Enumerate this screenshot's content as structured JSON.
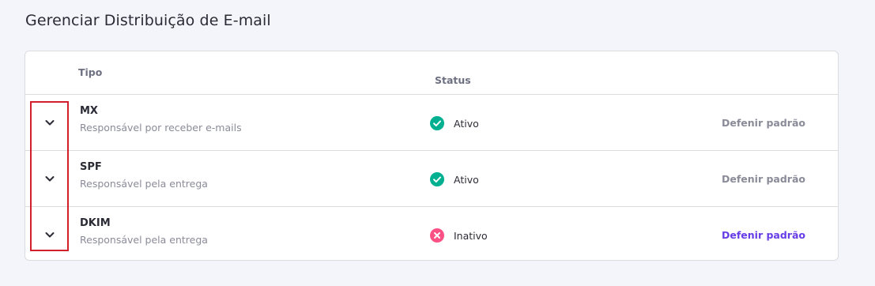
{
  "page": {
    "title": "Gerenciar Distribuição de E-mail"
  },
  "table": {
    "headers": {
      "type": "Tipo",
      "status": "Status"
    },
    "rows": [
      {
        "name": "MX",
        "description": "Responsável por receber e-mails",
        "status": "Ativo",
        "status_icon": "check-circle-icon",
        "action": "Defenir padrão",
        "action_state": "default"
      },
      {
        "name": "SPF",
        "description": "Responsável pela entrega",
        "status": "Ativo",
        "status_icon": "check-circle-icon",
        "action": "Defenir padrão",
        "action_state": "default"
      },
      {
        "name": "DKIM",
        "description": "Responsável pela entrega",
        "status": "Inativo",
        "status_icon": "x-circle-icon",
        "action": "Defenir padrão",
        "action_state": "active"
      }
    ]
  },
  "colors": {
    "background": "#f4f5fa",
    "active_green": "#00b090",
    "inactive_red": "#fc5185",
    "link_purple": "#673de6",
    "highlight_red": "#d11f2c"
  }
}
